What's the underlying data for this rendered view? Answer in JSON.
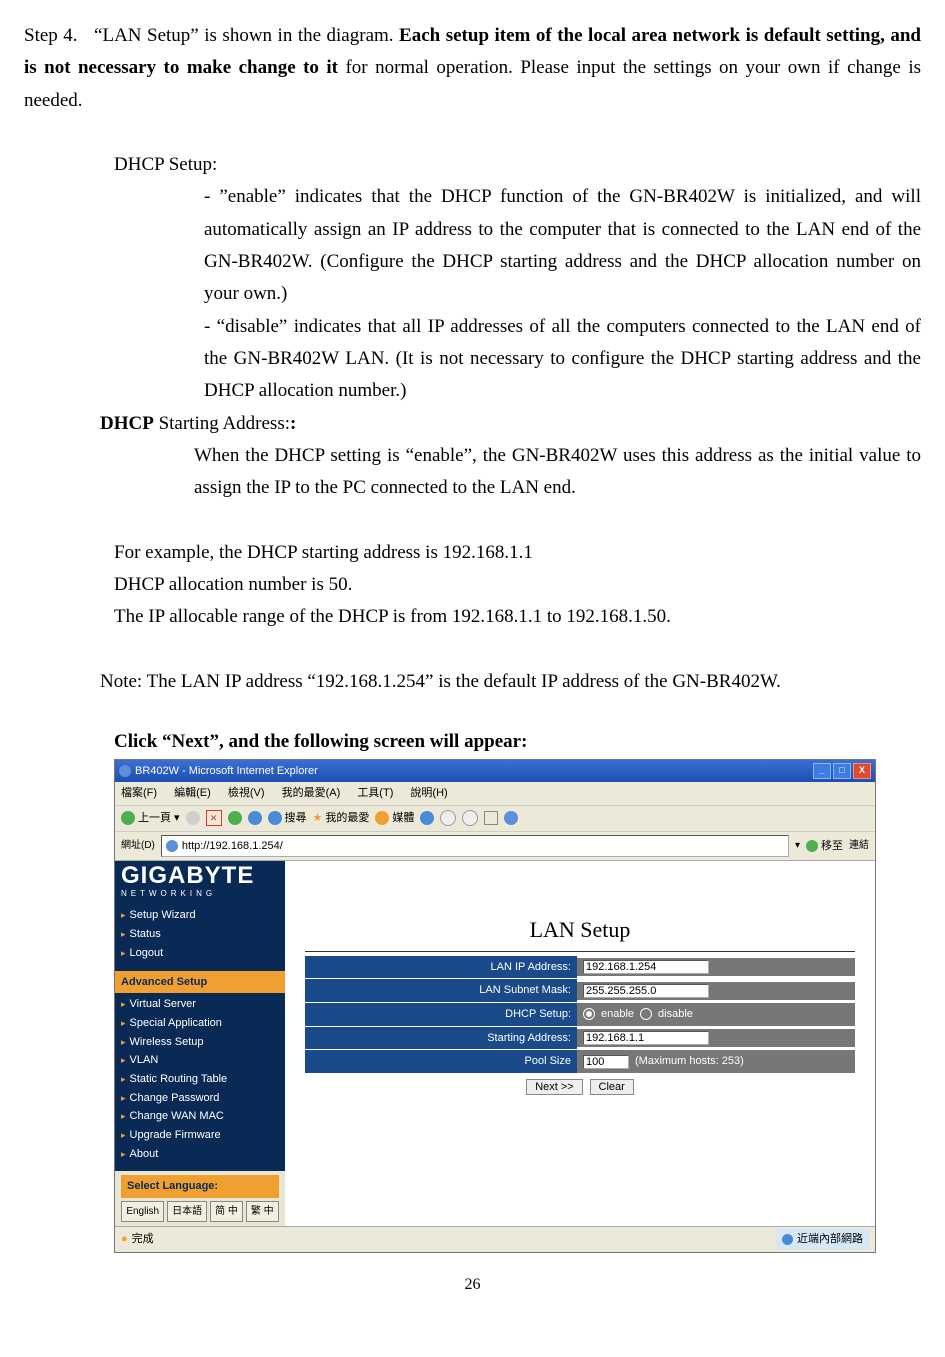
{
  "doc": {
    "step_label": "Step 4.",
    "step_para": "“LAN Setup” is shown in the diagram.    ",
    "step_bold": "Each setup item of the local area network is default setting, and is not necessary to make change to it",
    "step_tail": " for normal operation.  Please input the settings on your own if change is needed.",
    "dhcp_setup_h": "DHCP Setup:",
    "dhcp_enable": "- ”enable” indicates that the DHCP function of the GN-BR402W is initialized, and will automatically assign an IP address to the computer that is connected to the LAN end of the GN-BR402W.   (Configure the DHCP starting address and the DHCP allocation number on your own.)",
    "dhcp_disable": "- “disable” indicates that all IP addresses of all the computers connected to the LAN end of the GN-BR402W LAN. (It is not necessary to configure the DHCP starting address and the DHCP allocation number.)",
    "dhcp_start_h1": "DHCP",
    "dhcp_start_h2": " Starting Address:",
    "dhcp_start_colon": ":",
    "dhcp_start_p": "When the DHCP setting is “enable”, the GN-BR402W uses this address as the initial value to assign the IP to the PC connected to the LAN end.",
    "example_1": "For example, the DHCP starting address is 192.168.1.1",
    "example_2": "DHCP allocation number is 50.",
    "example_3": "The IP allocable range of the DHCP is from 192.168.1.1 to 192.168.1.50.",
    "note": "Note:   The  LAN IP address “192.168.1.254” is the default IP address of the GN-BR402W.",
    "click_next": "Click “Next”, and the following screen will appear:",
    "page_number": "26"
  },
  "browser": {
    "title": "BR402W - Microsoft Internet Explorer",
    "menus": [
      "檔案(F)",
      "編輯(E)",
      "檢視(V)",
      "我的最愛(A)",
      "工具(T)",
      "說明(H)"
    ],
    "back": "上一頁",
    "search": "搜尋",
    "fav": "我的最愛",
    "media": "媒體",
    "addr_label": "網址(D)",
    "addr_value": "http://192.168.1.254/",
    "go": "移至",
    "links": "連結",
    "status_left": "完成",
    "status_right": "近端內部網路"
  },
  "sidebar": {
    "logo_main": "GIGABYTE",
    "logo_sub": "NETWORKING",
    "basic": [
      "Setup Wizard",
      "Status",
      "Logout"
    ],
    "adv_heading": "Advanced Setup",
    "advanced": [
      "Virtual Server",
      "Special Application",
      "Wireless Setup",
      "VLAN",
      "Static Routing Table",
      "Change Password",
      "Change WAN MAC",
      "Upgrade Firmware",
      "About"
    ],
    "lang_heading": "Select Language:",
    "langs": [
      "English",
      "日本語",
      "简 中",
      "繁 中"
    ]
  },
  "form": {
    "title": "LAN Setup",
    "rows": {
      "lan_ip_label": "LAN IP Address:",
      "lan_ip_value": "192.168.1.254",
      "subnet_label": "LAN Subnet Mask:",
      "subnet_value": "255.255.255.0",
      "dhcp_label": "DHCP Setup:",
      "dhcp_enable": "enable",
      "dhcp_disable": "disable",
      "start_label": "Starting Address:",
      "start_value": "192.168.1.1",
      "pool_label": "Pool Size",
      "pool_value": "100",
      "pool_hint": "(Maximum hosts: 253)"
    },
    "buttons": {
      "next": "Next >>",
      "clear": "Clear"
    }
  }
}
